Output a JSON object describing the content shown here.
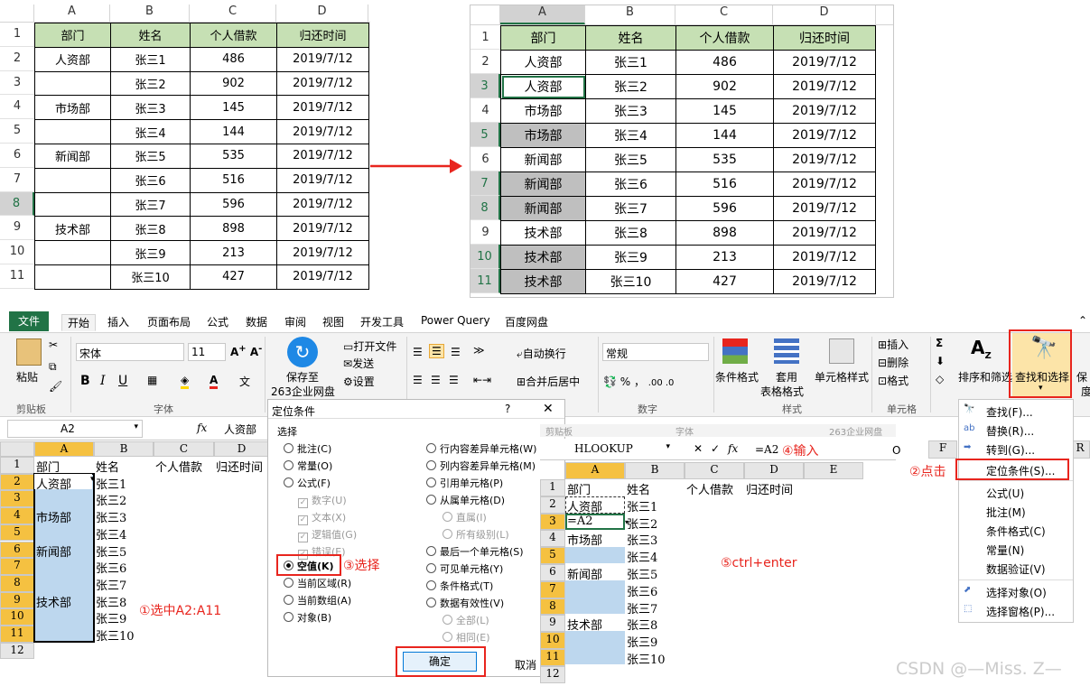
{
  "left_sheet": {
    "col_headers": [
      "A",
      "B",
      "C",
      "D"
    ],
    "row_headers": [
      "1",
      "2",
      "3",
      "4",
      "5",
      "6",
      "7",
      "8",
      "9",
      "10",
      "11"
    ],
    "header": [
      "部门",
      "姓名",
      "个人借款",
      "归还时间"
    ],
    "rows": [
      [
        "人资部",
        "张三1",
        "486",
        "2019/7/12"
      ],
      [
        "",
        "张三2",
        "902",
        "2019/7/12"
      ],
      [
        "市场部",
        "张三3",
        "145",
        "2019/7/12"
      ],
      [
        "",
        "张三4",
        "144",
        "2019/7/12"
      ],
      [
        "新闻部",
        "张三5",
        "535",
        "2019/7/12"
      ],
      [
        "",
        "张三6",
        "516",
        "2019/7/12"
      ],
      [
        "",
        "张三7",
        "596",
        "2019/7/12"
      ],
      [
        "技术部",
        "张三8",
        "898",
        "2019/7/12"
      ],
      [
        "",
        "张三9",
        "213",
        "2019/7/12"
      ],
      [
        "",
        "张三10",
        "427",
        "2019/7/12"
      ]
    ]
  },
  "right_sheet": {
    "col_headers": [
      "A",
      "B",
      "C",
      "D"
    ],
    "row_headers": [
      "1",
      "2",
      "3",
      "4",
      "5",
      "6",
      "7",
      "8",
      "9",
      "10",
      "11"
    ],
    "header": [
      "部门",
      "姓名",
      "个人借款",
      "归还时间"
    ],
    "rows": [
      [
        "人资部",
        "张三1",
        "486",
        "2019/7/12"
      ],
      [
        "人资部",
        "张三2",
        "902",
        "2019/7/12"
      ],
      [
        "市场部",
        "张三3",
        "145",
        "2019/7/12"
      ],
      [
        "市场部",
        "张三4",
        "144",
        "2019/7/12"
      ],
      [
        "新闻部",
        "张三5",
        "535",
        "2019/7/12"
      ],
      [
        "新闻部",
        "张三6",
        "516",
        "2019/7/12"
      ],
      [
        "新闻部",
        "张三7",
        "596",
        "2019/7/12"
      ],
      [
        "技术部",
        "张三8",
        "898",
        "2019/7/12"
      ],
      [
        "技术部",
        "张三9",
        "213",
        "2019/7/12"
      ],
      [
        "技术部",
        "张三10",
        "427",
        "2019/7/12"
      ]
    ]
  },
  "tabs": [
    "文件",
    "开始",
    "插入",
    "页面布局",
    "公式",
    "数据",
    "审阅",
    "视图",
    "开发工具",
    "Power Query",
    "百度网盘"
  ],
  "ribbon": {
    "paste": "粘贴",
    "clipboard": "剪贴板",
    "font_name": "宋体",
    "font_size": "11",
    "font_group": "字体",
    "save_to": "保存至",
    "cloud": "263企业网盘",
    "open_file": "打开文件",
    "send": "发送",
    "settings": "设置",
    "wrap": "自动换行",
    "merge": "合并后居中",
    "number_format": "常规",
    "number_group": "数字",
    "cond_format": "条件格式",
    "table_format_1": "套用",
    "table_format_2": "表格格式",
    "cell_style": "单元格样式",
    "style_group": "样式",
    "insert": "插入",
    "delete": "删除",
    "format": "格式",
    "cells_group": "单元格",
    "sort": "排序和筛选",
    "find": "查找和选择",
    "truncated": "保",
    "truncated2": "度"
  },
  "excel1": {
    "namebox": "A2",
    "formula": "人资部",
    "cols": [
      "A",
      "B",
      "C",
      "D"
    ],
    "rows": [
      "1",
      "2",
      "3",
      "4",
      "5",
      "6",
      "7",
      "8",
      "9",
      "10",
      "11",
      "12"
    ],
    "header": [
      "部门",
      "姓名",
      "个人借款",
      "归还时间"
    ],
    "colA": [
      "人资部",
      "",
      "市场部",
      "",
      "新闻部",
      "",
      "",
      "技术部",
      "",
      ""
    ],
    "colB": [
      "张三1",
      "张三2",
      "张三3",
      "张三4",
      "张三5",
      "张三6",
      "张三7",
      "张三8",
      "张三9",
      "张三10"
    ]
  },
  "dialog": {
    "title": "定位条件",
    "help": "?",
    "close": "✕",
    "group": "选择",
    "left": [
      "批注(C)",
      "常量(O)",
      "公式(F)",
      "空值(K)",
      "当前区域(R)",
      "当前数组(A)",
      "对象(B)"
    ],
    "checks": [
      "数字(U)",
      "文本(X)",
      "逻辑值(G)",
      "错误(E)"
    ],
    "right": [
      "行内容差异单元格(W)",
      "列内容差异单元格(M)",
      "引用单元格(P)",
      "从属单元格(D)",
      "直属(I)",
      "所有级别(L)",
      "最后一个单元格(S)",
      "可见单元格(Y)",
      "条件格式(T)",
      "数据有效性(V)",
      "全部(L)",
      "相同(E)"
    ],
    "ok": "确定",
    "cancel": "取消"
  },
  "excel2": {
    "namebox": "HLOOKUP",
    "formula": "=A2",
    "cols": [
      "A",
      "B",
      "C",
      "D",
      "E"
    ],
    "rows": [
      "1",
      "2",
      "3",
      "4",
      "5",
      "6",
      "7",
      "8",
      "9",
      "10",
      "11",
      "12"
    ],
    "header": [
      "部门",
      "姓名",
      "个人借款",
      "归还时间"
    ],
    "colA": [
      "人资部",
      "=A2",
      "市场部",
      "",
      "新闻部",
      "",
      "",
      "技术部",
      "",
      ""
    ],
    "colB": [
      "张三1",
      "张三2",
      "张三3",
      "张三4",
      "张三5",
      "张三6",
      "张三7",
      "张三8",
      "张三9",
      "张三10"
    ],
    "ghost_title": "剪贴板",
    "ghost_mid": "字体",
    "ghost_right": "263企业网盘",
    "col_f": "F",
    "col_r": "R",
    "col_o": "O"
  },
  "menu": [
    "查找(F)...",
    "替换(R)...",
    "转到(G)...",
    "定位条件(S)...",
    "公式(U)",
    "批注(M)",
    "条件格式(C)",
    "常量(N)",
    "数据验证(V)",
    "选择对象(O)",
    "选择窗格(P)..."
  ],
  "annotations": {
    "a1": "①选中A2:A11",
    "a2": "②点击",
    "a3": "③选择",
    "a4": "④输入",
    "a5": "⑤ctrl+enter"
  },
  "watermark": "CSDN @—Miss. Z—",
  "colors": {
    "header_green": "#c6e0b4",
    "gray_fill": "#bfbfbf",
    "selection_blue": "#bdd7ee",
    "excel_green": "#217346",
    "annotation_red": "#e8251e"
  }
}
